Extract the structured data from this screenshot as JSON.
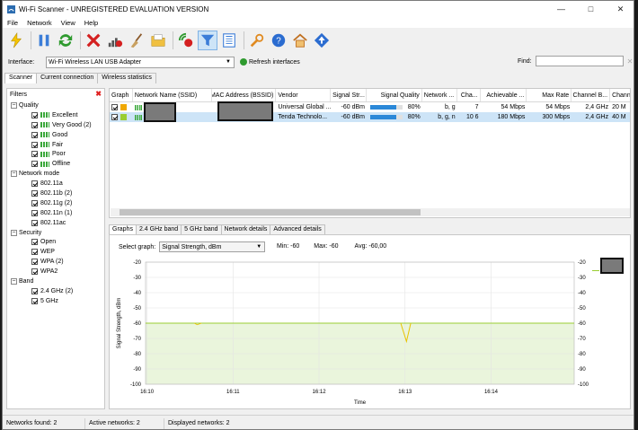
{
  "app": {
    "title": "Wi-Fi Scanner - UNREGISTERED EVALUATION VERSION"
  },
  "menu": [
    "File",
    "Network",
    "View",
    "Help"
  ],
  "interface": {
    "label": "Interface:",
    "value": "Wi-Fi Wireless LAN USB Adapter",
    "refresh_label": "Refresh interfaces"
  },
  "find": {
    "label": "Find:"
  },
  "main_tabs": [
    "Scanner",
    "Current connection",
    "Wireless statistics"
  ],
  "filters": {
    "header": "Filters",
    "groups": [
      {
        "label": "Quality",
        "items": [
          "Excellent",
          "Very Good (2)",
          "Good",
          "Fair",
          "Poor",
          "Offline"
        ]
      },
      {
        "label": "Network mode",
        "items": [
          "802.11a",
          "802.11b (2)",
          "802.11g (2)",
          "802.11n (1)",
          "802.11ac"
        ]
      },
      {
        "label": "Security",
        "items": [
          "Open",
          "WEP",
          "WPA (2)",
          "WPA2"
        ]
      },
      {
        "label": "Band",
        "items": [
          "2.4 GHz (2)",
          "5 GHz"
        ]
      }
    ]
  },
  "table": {
    "columns": [
      "Graph",
      "Network Name (SSID)",
      "MAC Address (BSSID)",
      "Vendor",
      "Signal Str...",
      "Signal Quality",
      "Network ...",
      "Cha...",
      "Achievable ...",
      "Max Rate",
      "Channel B...",
      "Channe"
    ],
    "rows": [
      {
        "graph_color": "#f0a800",
        "vendor": "Universal Global ...",
        "signal": "-60 dBm",
        "quality": 80,
        "quality_text": "80%",
        "mode": "b, g",
        "channel": "7",
        "achievable": "54 Mbps",
        "max_rate": "54 Mbps",
        "band": "2,4 GHz",
        "width": "20 M"
      },
      {
        "graph_color": "#9acd32",
        "vendor": "Tenda Technolo...",
        "signal": "-60 dBm",
        "quality": 80,
        "quality_text": "80%",
        "mode": "b, g, n",
        "channel": "10 6",
        "achievable": "180 Mbps",
        "max_rate": "300 Mbps",
        "band": "2,4 GHz",
        "width": "40 M"
      }
    ]
  },
  "bottom_tabs": [
    "Graphs",
    "2.4 GHz band",
    "5 GHz band",
    "Network details",
    "Advanced details"
  ],
  "graph": {
    "select_label": "Select graph:",
    "selected": "Signal Strength, dBm",
    "min": "Min:  -60",
    "max": "Max:  -60",
    "avg": "Avg:  -60,00"
  },
  "chart_data": {
    "type": "line",
    "ylabel": "Signal Strength, dBm",
    "xlabel": "Time",
    "ylim": [
      -100,
      -20
    ],
    "yticks": [
      -20,
      -30,
      -40,
      -50,
      -60,
      -70,
      -80,
      -90,
      -100
    ],
    "xticks": [
      "16:10",
      "16:11",
      "16:12",
      "16:13",
      "16:14"
    ],
    "grid": true,
    "series": [
      {
        "color": "#9acd32",
        "x": [
          "16:10",
          "16:14"
        ],
        "values": [
          -60,
          -60
        ]
      },
      {
        "color": "#e8c400",
        "x": [
          "16:12:57",
          "16:13:01",
          "16:13:04"
        ],
        "values": [
          -60,
          -72,
          -60
        ]
      }
    ]
  },
  "status": {
    "found": "Networks found: 2",
    "active": "Active networks: 2",
    "displayed": "Displayed networks: 2"
  }
}
